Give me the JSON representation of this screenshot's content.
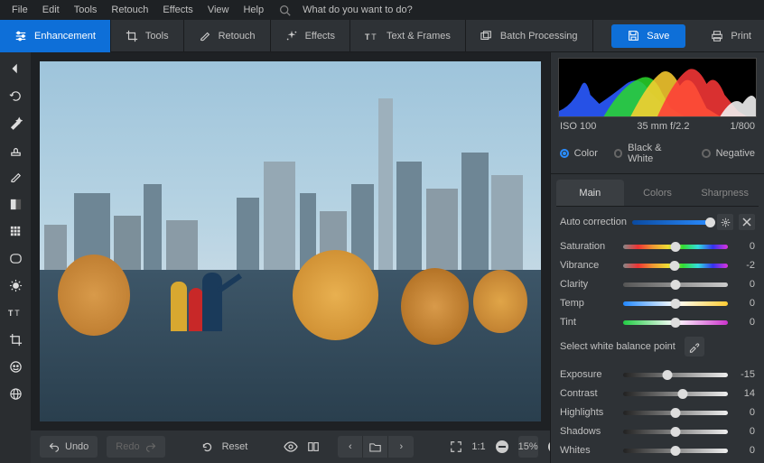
{
  "menu": {
    "items": [
      "File",
      "Edit",
      "Tools",
      "Retouch",
      "Effects",
      "View",
      "Help"
    ],
    "search_placeholder": "What do you want to do?"
  },
  "toolbar": {
    "tabs": [
      {
        "label": "Enhancement",
        "active": true
      },
      {
        "label": "Tools",
        "active": false
      },
      {
        "label": "Retouch",
        "active": false
      },
      {
        "label": "Effects",
        "active": false
      },
      {
        "label": "Text & Frames",
        "active": false
      },
      {
        "label": "Batch Processing",
        "active": false
      }
    ],
    "save": "Save",
    "print": "Print"
  },
  "histo": {
    "iso": "ISO 100",
    "lens": "35 mm f/2.2",
    "shutter": "1/800"
  },
  "modes": {
    "color": "Color",
    "bw": "Black & White",
    "neg": "Negative",
    "selected": "color"
  },
  "panel_tabs": {
    "main": "Main",
    "colors": "Colors",
    "sharpness": "Sharpness",
    "active": "main"
  },
  "auto": {
    "label": "Auto correction"
  },
  "sliders": [
    {
      "name": "Saturation",
      "value": 0,
      "grad": "linear-gradient(90deg,#888,#e33,#e93,#ed3,#3d3,#3dd,#33e,#d3d)"
    },
    {
      "name": "Vibrance",
      "value": -2,
      "grad": "linear-gradient(90deg,#888,#e33,#e93,#ed3,#3d3,#3dd,#33e,#d3d)"
    },
    {
      "name": "Clarity",
      "value": 0,
      "grad": "linear-gradient(90deg,#555,#ccc)"
    },
    {
      "name": "Temp",
      "value": 0,
      "grad": "linear-gradient(90deg,#28f,#fff,#fc3)"
    },
    {
      "name": "Tint",
      "value": 0,
      "grad": "linear-gradient(90deg,#2c4,#fff,#c3c)"
    }
  ],
  "wb": {
    "label": "Select white balance point"
  },
  "sliders2": [
    {
      "name": "Exposure",
      "value": -15
    },
    {
      "name": "Contrast",
      "value": 14
    },
    {
      "name": "Highlights",
      "value": 0
    },
    {
      "name": "Shadows",
      "value": 0
    },
    {
      "name": "Whites",
      "value": 0
    }
  ],
  "bottom": {
    "undo": "Undo",
    "redo": "Redo",
    "reset": "Reset",
    "ratio": "1:1",
    "zoom": "15%"
  }
}
